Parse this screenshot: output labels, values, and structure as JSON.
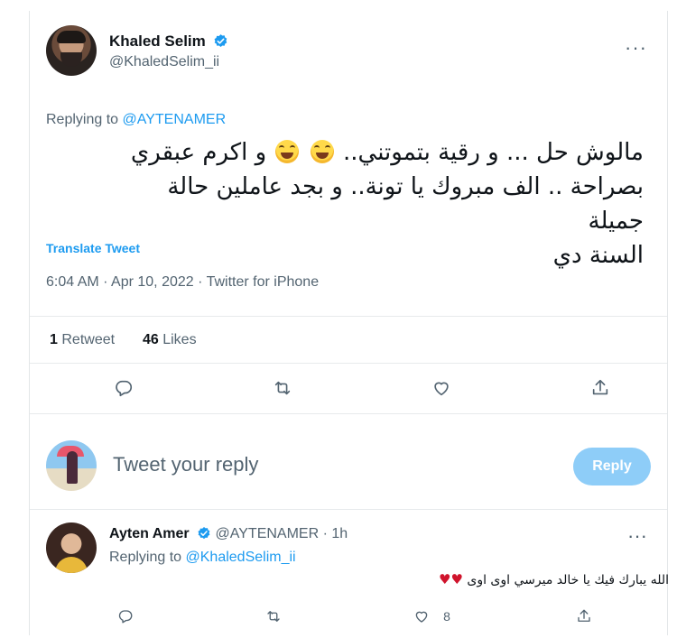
{
  "tweet": {
    "author": {
      "display_name": "Khaled Selim",
      "handle": "@KhaledSelim_ii"
    },
    "more_label": "···",
    "replying_prefix": "Replying to",
    "replying_to": "@AYTENAMER",
    "text_line1_a": "مالوش حل ... و رقية بتموتني..",
    "text_line1_b": "و اكرم عبقري",
    "text_line2": "بصراحة .. الف مبروك يا تونة.. و بجد عاملين حالة جميلة",
    "text_line3": "السنة دي",
    "translate_label": "Translate Tweet",
    "meta": "6:04 AM · Apr 10, 2022 · Twitter for iPhone",
    "stats": {
      "retweets_count": "1",
      "retweets_label": "Retweet",
      "likes_count": "46",
      "likes_label": "Likes"
    }
  },
  "composer": {
    "placeholder": "Tweet your reply",
    "button_label": "Reply"
  },
  "reply": {
    "display_name": "Ayten Amer",
    "handle": "@AYTENAMER",
    "dot": "·",
    "time": "1h",
    "replying_prefix": "Replying to",
    "replying_to": "@KhaledSelim_ii",
    "text": "الله يبارك فيك يا خالد ميرسي اوى اوى",
    "hearts": "♥♥",
    "like_count": "8",
    "more_label": "···"
  },
  "colors": {
    "accent": "#1d9bf0",
    "muted": "#536471",
    "reply_button_disabled": "#8ecdf8",
    "heart": "#d0142c"
  }
}
